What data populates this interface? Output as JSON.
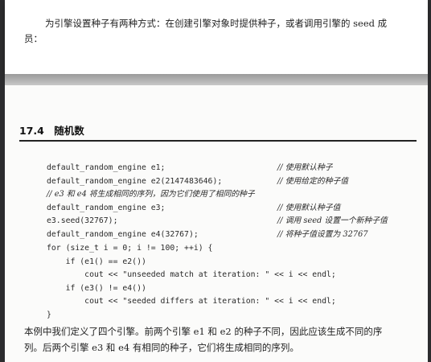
{
  "top_paragraph": {
    "line1": "为引擎设置种子有两种方式：在创建引擎对象时提供种子，或者调用引擎的 seed 成",
    "line2": "员："
  },
  "section": {
    "number": "17.4",
    "title": "随机数"
  },
  "code_lines": [
    {
      "code": "default_random_engine e1;",
      "comment": "// 使用默认种子"
    },
    {
      "code": "default_random_engine e2(2147483646);",
      "comment": "// 使用给定的种子值"
    },
    {
      "code": "// e3 和 e4 将生成相同的序列，因为它们使用了相同的种子",
      "comment": ""
    },
    {
      "code": "default_random_engine e3;",
      "comment": "// 使用默认种子值"
    },
    {
      "code": "e3.seed(32767);",
      "comment": "// 调用 seed 设置一个新种子值"
    },
    {
      "code": "default_random_engine e4(32767);",
      "comment": "// 将种子值设置为 32767"
    },
    {
      "code": "for (size_t i = 0; i != 100; ++i) {",
      "comment": ""
    },
    {
      "code": "    if (e1() == e2())",
      "comment": ""
    },
    {
      "code": "        cout << \"unseeded match at iteration: \" << i << endl;",
      "comment": ""
    },
    {
      "code": "    if (e3() != e4())",
      "comment": ""
    },
    {
      "code": "        cout << \"seeded differs at iteration: \" << i << endl;",
      "comment": ""
    },
    {
      "code": "}",
      "comment": ""
    }
  ],
  "bottom_paragraph": {
    "line1": "本例中我们定义了四个引擎。前两个引擎 e1 和 e2 的种子不同，因此应该生成不同的序",
    "line2": "列。后两个引擎 e3 和 e4 有相同的种子，它们将生成相同的序列。"
  }
}
